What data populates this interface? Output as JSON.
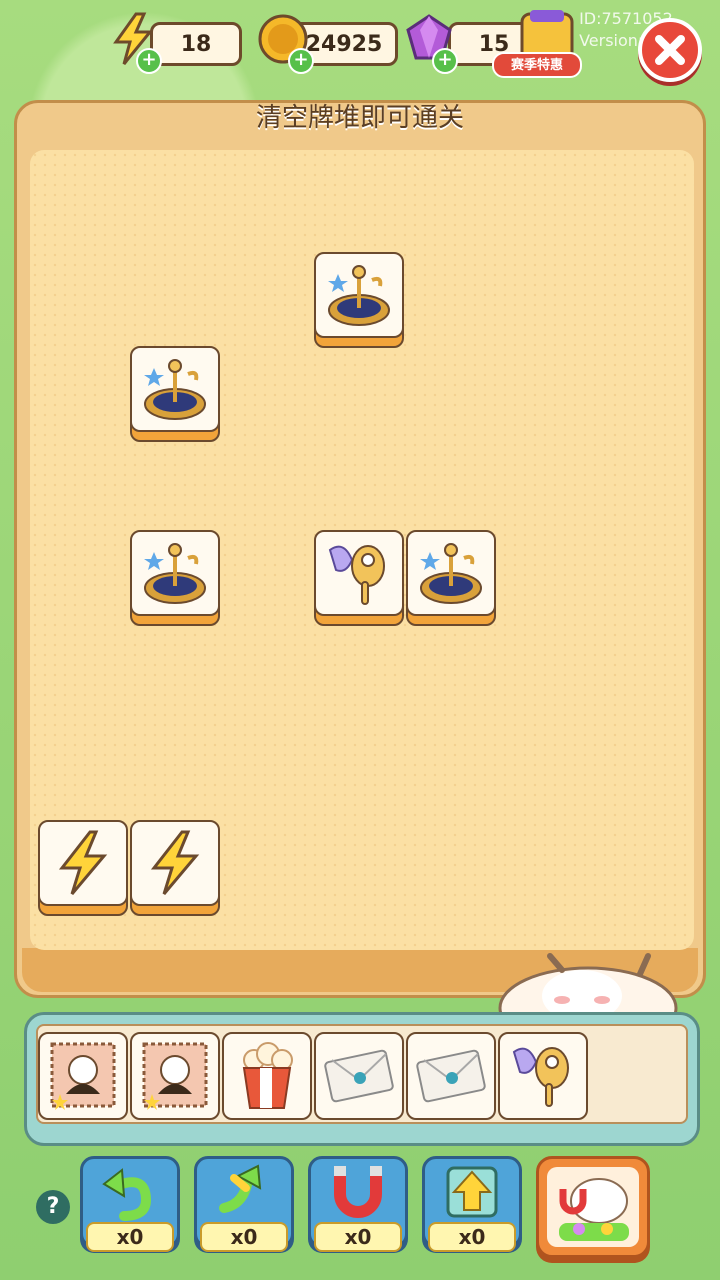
{
  "resources": {
    "energy": {
      "value": "18",
      "icon": "lightning-icon"
    },
    "coins": {
      "value": "24925",
      "icon": "coin-icon"
    },
    "gems": {
      "value": "15",
      "icon": "gem-icon"
    }
  },
  "season_offer": {
    "label": "赛季特惠"
  },
  "meta": {
    "id": "ID:7571052",
    "version": "Version:4.7.4"
  },
  "board": {
    "hint": "清空牌堆即可通关",
    "tiles": [
      {
        "type": "clock-stand",
        "icon": "clock-stand-icon"
      },
      {
        "type": "clock-stand",
        "icon": "clock-stand-icon"
      },
      {
        "type": "clock-stand",
        "icon": "clock-stand-icon"
      },
      {
        "type": "masquerade-mask",
        "icon": "mask-icon"
      },
      {
        "type": "clock-stand",
        "icon": "clock-stand-icon"
      },
      {
        "type": "lightning",
        "icon": "lightning-icon"
      },
      {
        "type": "lightning",
        "icon": "lightning-icon"
      }
    ]
  },
  "tray": {
    "slots": [
      {
        "type": "stamp",
        "icon": "stamp-icon"
      },
      {
        "type": "stamp",
        "icon": "stamp-icon"
      },
      {
        "type": "popcorn",
        "icon": "popcorn-icon"
      },
      {
        "type": "envelope",
        "icon": "envelope-icon"
      },
      {
        "type": "envelope",
        "icon": "envelope-icon"
      },
      {
        "type": "masquerade-mask",
        "icon": "mask-icon"
      }
    ]
  },
  "tools": [
    {
      "name": "undo",
      "count": "x0",
      "icon": "undo-arrow-icon"
    },
    {
      "name": "shuffle",
      "count": "x0",
      "icon": "shuffle-icon"
    },
    {
      "name": "magnet",
      "count": "x0",
      "icon": "magnet-icon"
    },
    {
      "name": "move-out",
      "count": "x0",
      "icon": "up-arrow-icon"
    }
  ],
  "help": {
    "label": "?"
  },
  "colors": {
    "accent": "#f2a43a",
    "tray": "#9dd6d0",
    "board": "#fbe0a4",
    "tool": "#4fa4d9"
  }
}
